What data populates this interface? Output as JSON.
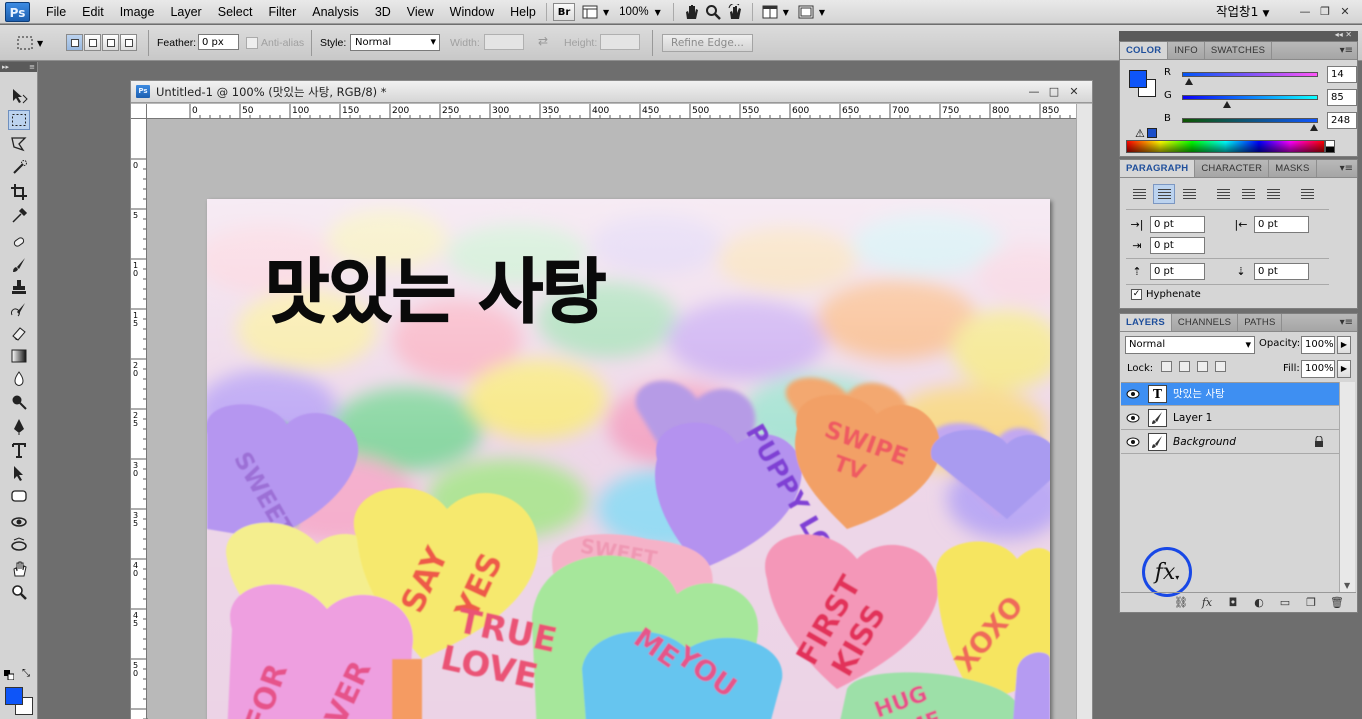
{
  "app": {
    "logo": "Ps",
    "menu": [
      "File",
      "Edit",
      "Image",
      "Layer",
      "Select",
      "Filter",
      "Analysis",
      "3D",
      "View",
      "Window",
      "Help"
    ],
    "bridge_label": "Br",
    "zoom_level": "100%",
    "workspace": "작업창1",
    "window_controls": [
      "—",
      "❐",
      "✕"
    ]
  },
  "options_bar": {
    "feather_label": "Feather:",
    "feather_value": "0 px",
    "antialias_label": "Anti-alias",
    "style_label": "Style:",
    "style_value": "Normal",
    "width_label": "Width:",
    "height_label": "Height:",
    "refine_edge_label": "Refine Edge..."
  },
  "document": {
    "title": "Untitled-1 @ 100% (맛있는 사탕, RGB/8) *",
    "controls": [
      "—",
      "□",
      "✕"
    ],
    "headline_text": "맛있는 사탕",
    "ruler_h_labels": [
      "0",
      "50",
      "100",
      "150",
      "200",
      "250",
      "300",
      "350",
      "400",
      "450",
      "500",
      "550",
      "600",
      "650",
      "700",
      "750",
      "800",
      "850"
    ],
    "ruler_v_labels": [
      "0",
      "5",
      "1 0",
      "1 5",
      "2 0",
      "2 5",
      "3 0",
      "3 5",
      "4 0",
      "4 5",
      "5 0"
    ]
  },
  "color_panel": {
    "tabs": [
      "COLOR",
      "INFO",
      "SWATCHES"
    ],
    "channels": [
      {
        "label": "R",
        "value": "14",
        "fraction": 0.055
      },
      {
        "label": "G",
        "value": "85",
        "fraction": 0.333
      },
      {
        "label": "B",
        "value": "248",
        "fraction": 0.973
      }
    ],
    "foreground": "#0e55f8",
    "background": "#ffffff"
  },
  "paragraph_panel": {
    "tabs": [
      "PARAGRAPH",
      "CHARACTER",
      "MASKS"
    ],
    "indent_left": "0 pt",
    "indent_right": "0 pt",
    "indent_first": "0 pt",
    "space_before": "0 pt",
    "space_after": "0 pt",
    "hyphenate_label": "Hyphenate",
    "hyphenate_checked": true
  },
  "layers_panel": {
    "tabs": [
      "LAYERS",
      "CHANNELS",
      "PATHS"
    ],
    "blend_mode": "Normal",
    "opacity_label": "Opacity:",
    "opacity_value": "100%",
    "lock_label": "Lock:",
    "fill_label": "Fill:",
    "fill_value": "100%",
    "layers": [
      {
        "name": "맛있는 사탕",
        "type": "text",
        "thumb": "T",
        "selected": true,
        "visible": true
      },
      {
        "name": "Layer 1",
        "type": "pixel",
        "selected": false,
        "visible": true
      },
      {
        "name": "Background",
        "type": "pixel",
        "selected": false,
        "visible": true,
        "locked": true
      }
    ],
    "fx_label": "fx",
    "bottom_icons": [
      "link-icon",
      "fx-icon",
      "mask-icon",
      "adjustment-icon",
      "group-icon",
      "new-layer-icon",
      "trash-icon"
    ]
  },
  "colors": {
    "selection_blue": "#3e8ff2",
    "highlight_circle": "#1848e6",
    "panel_gray": "#d6d6d6"
  }
}
